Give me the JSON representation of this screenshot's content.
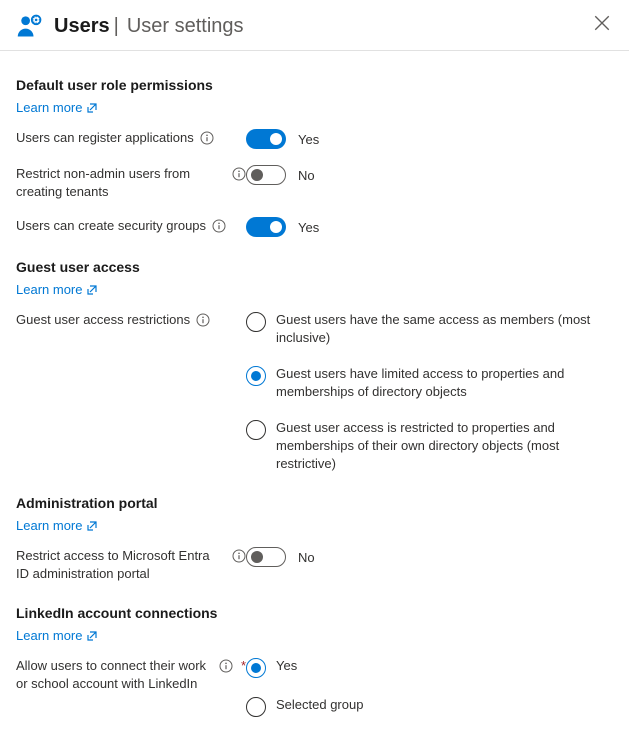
{
  "header": {
    "title": "Users",
    "subtitle": "User settings"
  },
  "sections": {
    "defaultPerms": {
      "title": "Default user role permissions",
      "learn": "Learn more",
      "items": {
        "registerApps": {
          "label": "Users can register applications",
          "value": "Yes"
        },
        "restrictTenants": {
          "label": "Restrict non-admin users from creating tenants",
          "value": "No"
        },
        "securityGroups": {
          "label": "Users can create security groups",
          "value": "Yes"
        }
      }
    },
    "guestAccess": {
      "title": "Guest user access",
      "learn": "Learn more",
      "label": "Guest user access restrictions",
      "options": {
        "inclusive": "Guest users have the same access as members (most inclusive)",
        "limited": "Guest users have limited access to properties and memberships of directory objects",
        "restrictive": "Guest user access is restricted to properties and memberships of their own directory objects (most restrictive)"
      }
    },
    "adminPortal": {
      "title": "Administration portal",
      "learn": "Learn more",
      "items": {
        "restrict": {
          "label": "Restrict access to Microsoft Entra ID administration portal",
          "value": "No"
        }
      }
    },
    "linkedin": {
      "title": "LinkedIn account connections",
      "learn": "Learn more",
      "label": "Allow users to connect their work or school account with LinkedIn",
      "options": {
        "yes": "Yes",
        "selected": "Selected group"
      }
    }
  }
}
